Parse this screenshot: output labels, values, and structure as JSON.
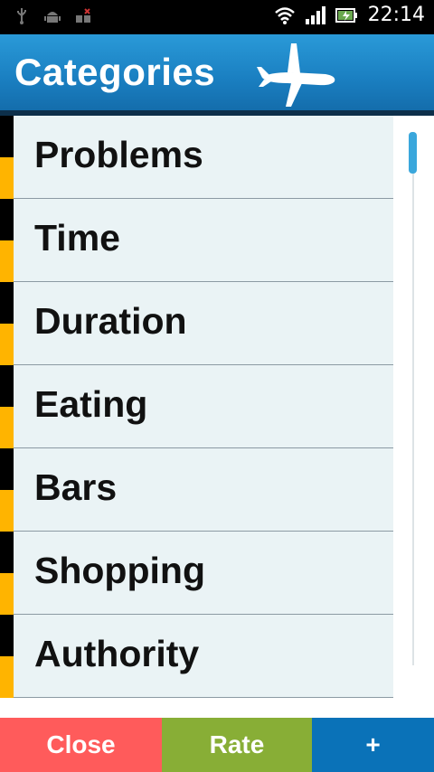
{
  "status_bar": {
    "time": "22:14",
    "icons": [
      "usb-icon",
      "android-debug-icon",
      "no-sim-icon",
      "wifi-icon",
      "signal-icon",
      "battery-charging-icon"
    ]
  },
  "header": {
    "title": "Categories",
    "icon": "airplane-icon"
  },
  "categories": [
    {
      "label": "Problems"
    },
    {
      "label": "Time"
    },
    {
      "label": "Duration"
    },
    {
      "label": "Eating"
    },
    {
      "label": "Bars"
    },
    {
      "label": "Shopping"
    },
    {
      "label": "Authority"
    }
  ],
  "bottom_bar": {
    "close_label": "Close",
    "rate_label": "Rate",
    "add_label": "+"
  },
  "colors": {
    "header": "#1a7fc1",
    "stripe_black": "#000000",
    "stripe_yellow": "#ffb400",
    "close": "#ff5b5b",
    "rate": "#88ae36",
    "add": "#0a72b8"
  }
}
